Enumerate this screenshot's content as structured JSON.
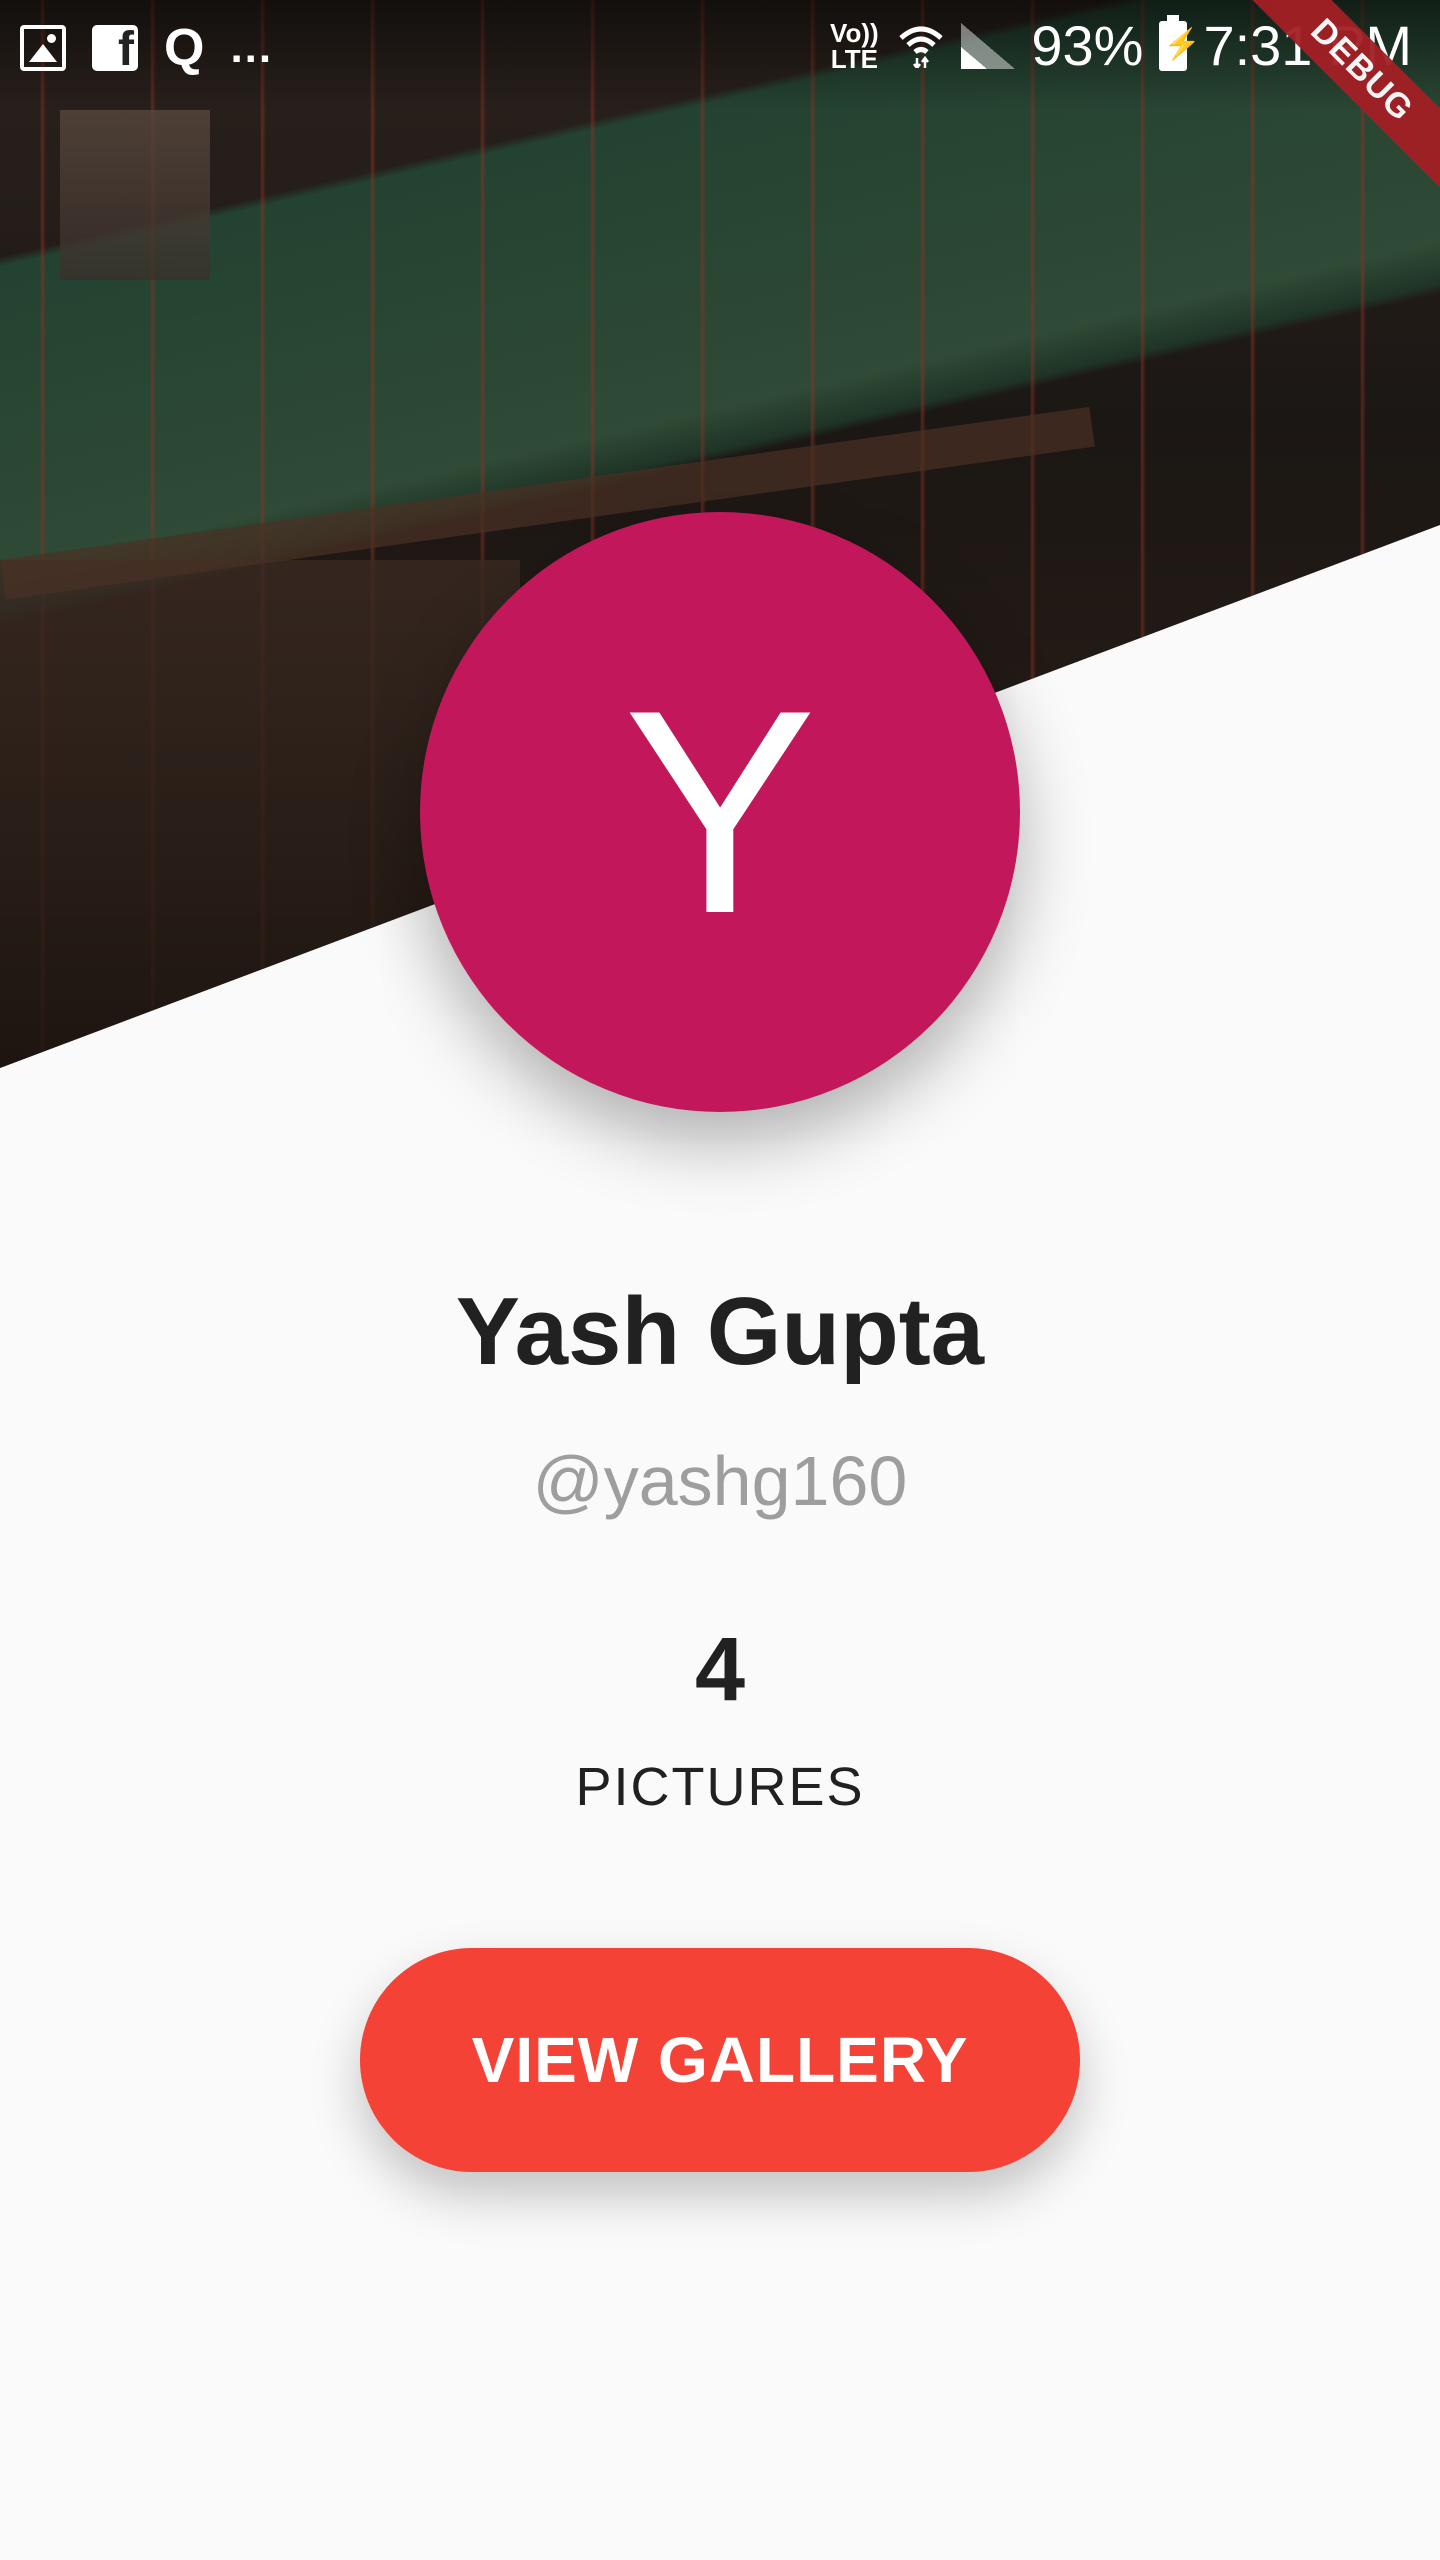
{
  "status_bar": {
    "notification_icons": [
      "image-icon",
      "facebook-icon",
      "quora-icon"
    ],
    "quora_glyph": "Q",
    "more_indicator": "...",
    "volte_label": "Vo))\nLTE",
    "battery_percent": "93%",
    "time": "7:31 PM"
  },
  "debug_banner": "DEBUG",
  "profile": {
    "avatar_letter": "Y",
    "avatar_color": "#c2185b",
    "name": "Yash Gupta",
    "handle": "@yashg160",
    "pictures_count": "4",
    "pictures_label": "PICTURES"
  },
  "actions": {
    "view_gallery_label": "VIEW GALLERY",
    "button_color": "#f44336"
  }
}
